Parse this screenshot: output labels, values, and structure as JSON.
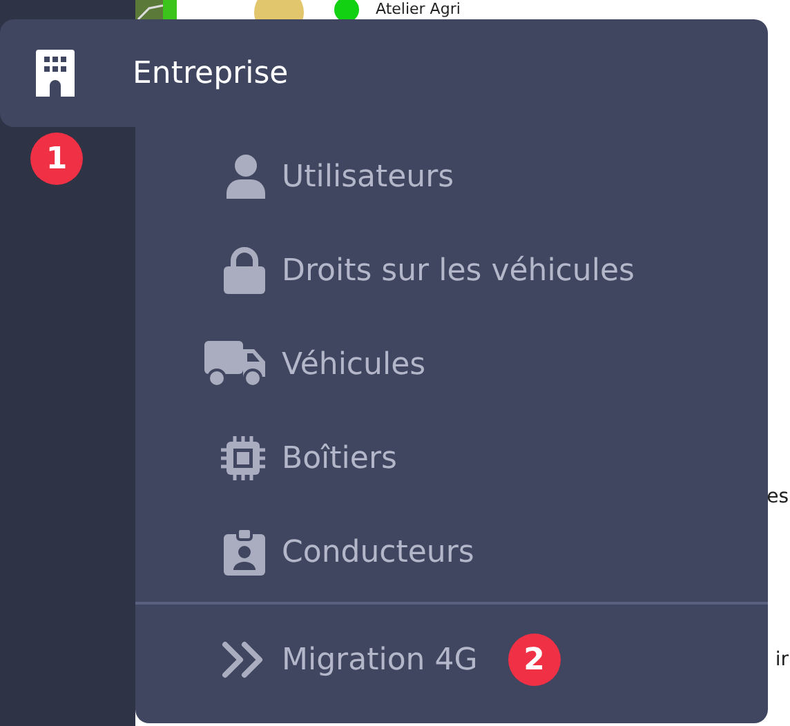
{
  "background": {
    "row_title": "Atelier Agri",
    "edge_texts": [
      {
        "text": "es"
      },
      {
        "text": "ir"
      }
    ]
  },
  "menu": {
    "title": "Entreprise",
    "badge": "1",
    "items": [
      {
        "label": "Utilisateurs",
        "kind": "user"
      },
      {
        "label": "Droits sur les véhicules",
        "kind": "lock"
      },
      {
        "label": "Véhicules",
        "kind": "truck"
      },
      {
        "label": "Boîtiers",
        "kind": "chip"
      },
      {
        "label": "Conducteurs",
        "kind": "driver"
      }
    ],
    "footer_item": {
      "label": "Migration 4G",
      "kind": "migration",
      "badge": "2"
    }
  }
}
